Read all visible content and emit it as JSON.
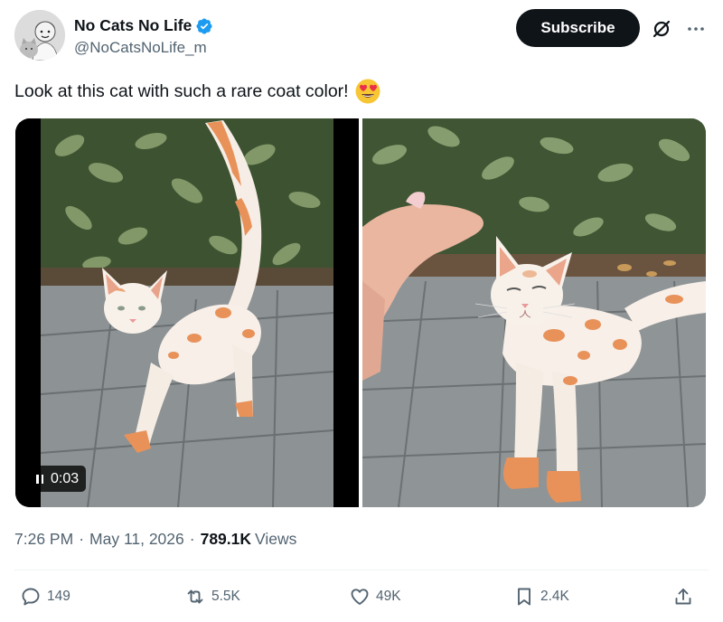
{
  "author": {
    "display_name": "No Cats No Life",
    "handle": "@NoCatsNoLife_m",
    "verified": true
  },
  "header": {
    "subscribe_label": "Subscribe"
  },
  "tweet": {
    "text": "Look at this cat with such a rare coat color!",
    "emoji": "smiling-face-with-heart-eyes"
  },
  "media": {
    "video_time": "0:03",
    "state": "paused"
  },
  "meta": {
    "time": "7:26 PM",
    "date": "May 11, 2026",
    "views_count": "789.1K",
    "views_label": "Views"
  },
  "actions": {
    "replies": "149",
    "reposts": "5.5K",
    "likes": "49K",
    "bookmarks": "2.4K"
  },
  "colors": {
    "text_primary": "#0f1419",
    "text_secondary": "#536471",
    "verified_blue": "#1d9bf0",
    "button_dark": "#0f1419"
  }
}
